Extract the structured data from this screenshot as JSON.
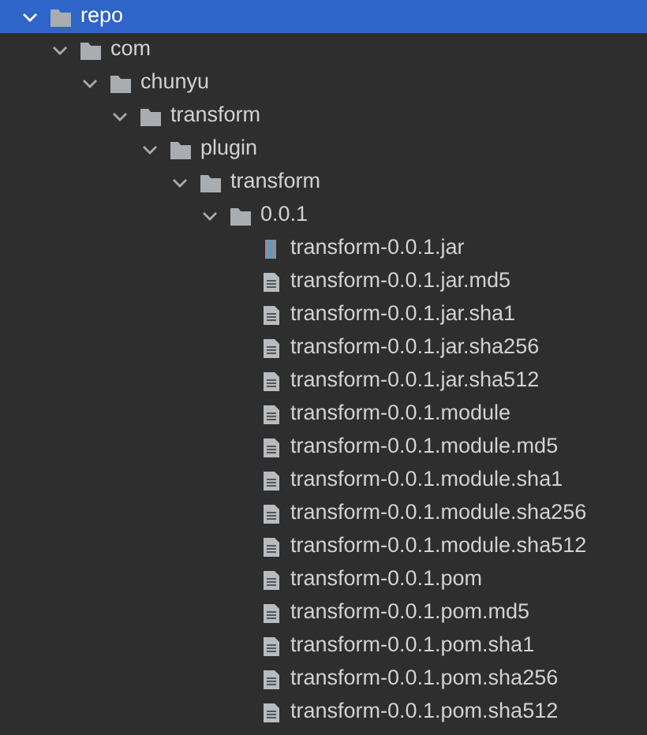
{
  "tree": [
    {
      "name": "repo",
      "kind": "folder",
      "expanded": true,
      "selected": true,
      "children": [
        {
          "name": "com",
          "kind": "folder",
          "expanded": true,
          "selected": false,
          "children": [
            {
              "name": "chunyu",
              "kind": "folder",
              "expanded": true,
              "selected": false,
              "children": [
                {
                  "name": "transform",
                  "kind": "folder",
                  "expanded": true,
                  "selected": false,
                  "children": [
                    {
                      "name": "plugin",
                      "kind": "folder",
                      "expanded": true,
                      "selected": false,
                      "children": [
                        {
                          "name": "transform",
                          "kind": "folder",
                          "expanded": true,
                          "selected": false,
                          "children": [
                            {
                              "name": "0.0.1",
                              "kind": "folder",
                              "expanded": true,
                              "selected": false,
                              "children": [
                                {
                                  "name": "transform-0.0.1.jar",
                                  "kind": "jar",
                                  "selected": false
                                },
                                {
                                  "name": "transform-0.0.1.jar.md5",
                                  "kind": "file",
                                  "selected": false
                                },
                                {
                                  "name": "transform-0.0.1.jar.sha1",
                                  "kind": "file",
                                  "selected": false
                                },
                                {
                                  "name": "transform-0.0.1.jar.sha256",
                                  "kind": "file",
                                  "selected": false
                                },
                                {
                                  "name": "transform-0.0.1.jar.sha512",
                                  "kind": "file",
                                  "selected": false
                                },
                                {
                                  "name": "transform-0.0.1.module",
                                  "kind": "file",
                                  "selected": false
                                },
                                {
                                  "name": "transform-0.0.1.module.md5",
                                  "kind": "file",
                                  "selected": false
                                },
                                {
                                  "name": "transform-0.0.1.module.sha1",
                                  "kind": "file",
                                  "selected": false
                                },
                                {
                                  "name": "transform-0.0.1.module.sha256",
                                  "kind": "file",
                                  "selected": false
                                },
                                {
                                  "name": "transform-0.0.1.module.sha512",
                                  "kind": "file",
                                  "selected": false
                                },
                                {
                                  "name": "transform-0.0.1.pom",
                                  "kind": "file",
                                  "selected": false
                                },
                                {
                                  "name": "transform-0.0.1.pom.md5",
                                  "kind": "file",
                                  "selected": false
                                },
                                {
                                  "name": "transform-0.0.1.pom.sha1",
                                  "kind": "file",
                                  "selected": false
                                },
                                {
                                  "name": "transform-0.0.1.pom.sha256",
                                  "kind": "file",
                                  "selected": false
                                },
                                {
                                  "name": "transform-0.0.1.pom.sha512",
                                  "kind": "file",
                                  "selected": false
                                }
                              ]
                            }
                          ]
                        }
                      ]
                    }
                  ]
                }
              ]
            }
          ]
        }
      ]
    }
  ]
}
